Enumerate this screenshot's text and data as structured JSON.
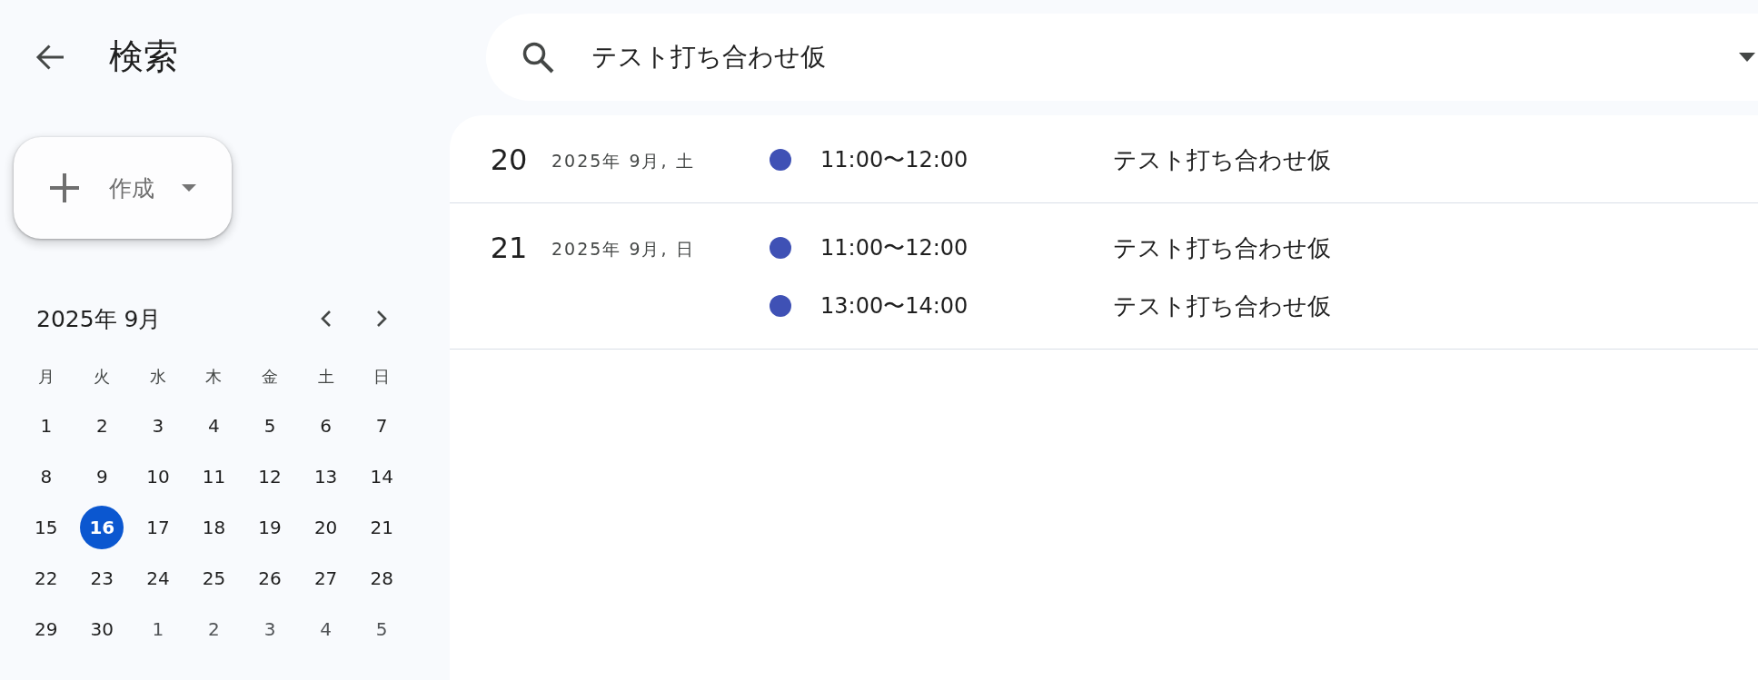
{
  "header": {
    "title": "検索"
  },
  "search": {
    "value": "テスト打ち合わせ仮"
  },
  "create_button": {
    "label": "作成"
  },
  "mini_calendar": {
    "title": "2025年 9月",
    "weekdays": [
      "月",
      "火",
      "水",
      "木",
      "金",
      "土",
      "日"
    ],
    "weeks": [
      [
        {
          "day": "1",
          "today": false,
          "other_month": false
        },
        {
          "day": "2",
          "today": false,
          "other_month": false
        },
        {
          "day": "3",
          "today": false,
          "other_month": false
        },
        {
          "day": "4",
          "today": false,
          "other_month": false
        },
        {
          "day": "5",
          "today": false,
          "other_month": false
        },
        {
          "day": "6",
          "today": false,
          "other_month": false
        },
        {
          "day": "7",
          "today": false,
          "other_month": false
        }
      ],
      [
        {
          "day": "8",
          "today": false,
          "other_month": false
        },
        {
          "day": "9",
          "today": false,
          "other_month": false
        },
        {
          "day": "10",
          "today": false,
          "other_month": false
        },
        {
          "day": "11",
          "today": false,
          "other_month": false
        },
        {
          "day": "12",
          "today": false,
          "other_month": false
        },
        {
          "day": "13",
          "today": false,
          "other_month": false
        },
        {
          "day": "14",
          "today": false,
          "other_month": false
        }
      ],
      [
        {
          "day": "15",
          "today": false,
          "other_month": false
        },
        {
          "day": "16",
          "today": true,
          "other_month": false
        },
        {
          "day": "17",
          "today": false,
          "other_month": false
        },
        {
          "day": "18",
          "today": false,
          "other_month": false
        },
        {
          "day": "19",
          "today": false,
          "other_month": false
        },
        {
          "day": "20",
          "today": false,
          "other_month": false
        },
        {
          "day": "21",
          "today": false,
          "other_month": false
        }
      ],
      [
        {
          "day": "22",
          "today": false,
          "other_month": false
        },
        {
          "day": "23",
          "today": false,
          "other_month": false
        },
        {
          "day": "24",
          "today": false,
          "other_month": false
        },
        {
          "day": "25",
          "today": false,
          "other_month": false
        },
        {
          "day": "26",
          "today": false,
          "other_month": false
        },
        {
          "day": "27",
          "today": false,
          "other_month": false
        },
        {
          "day": "28",
          "today": false,
          "other_month": false
        }
      ],
      [
        {
          "day": "29",
          "today": false,
          "other_month": false
        },
        {
          "day": "30",
          "today": false,
          "other_month": false
        },
        {
          "day": "1",
          "today": false,
          "other_month": true
        },
        {
          "day": "2",
          "today": false,
          "other_month": true
        },
        {
          "day": "3",
          "today": false,
          "other_month": true
        },
        {
          "day": "4",
          "today": false,
          "other_month": true
        },
        {
          "day": "5",
          "today": false,
          "other_month": true
        }
      ]
    ]
  },
  "results": [
    {
      "day": "20",
      "date": "2025年 9月, 土",
      "events": [
        {
          "time": "11:00〜12:00",
          "title": "テスト打ち合わせ仮",
          "color": "#3f51b5"
        }
      ]
    },
    {
      "day": "21",
      "date": "2025年 9月, 日",
      "events": [
        {
          "time": "11:00〜12:00",
          "title": "テスト打ち合わせ仮",
          "color": "#3f51b5"
        },
        {
          "time": "13:00〜14:00",
          "title": "テスト打ち合わせ仮",
          "color": "#3f51b5"
        }
      ]
    }
  ]
}
